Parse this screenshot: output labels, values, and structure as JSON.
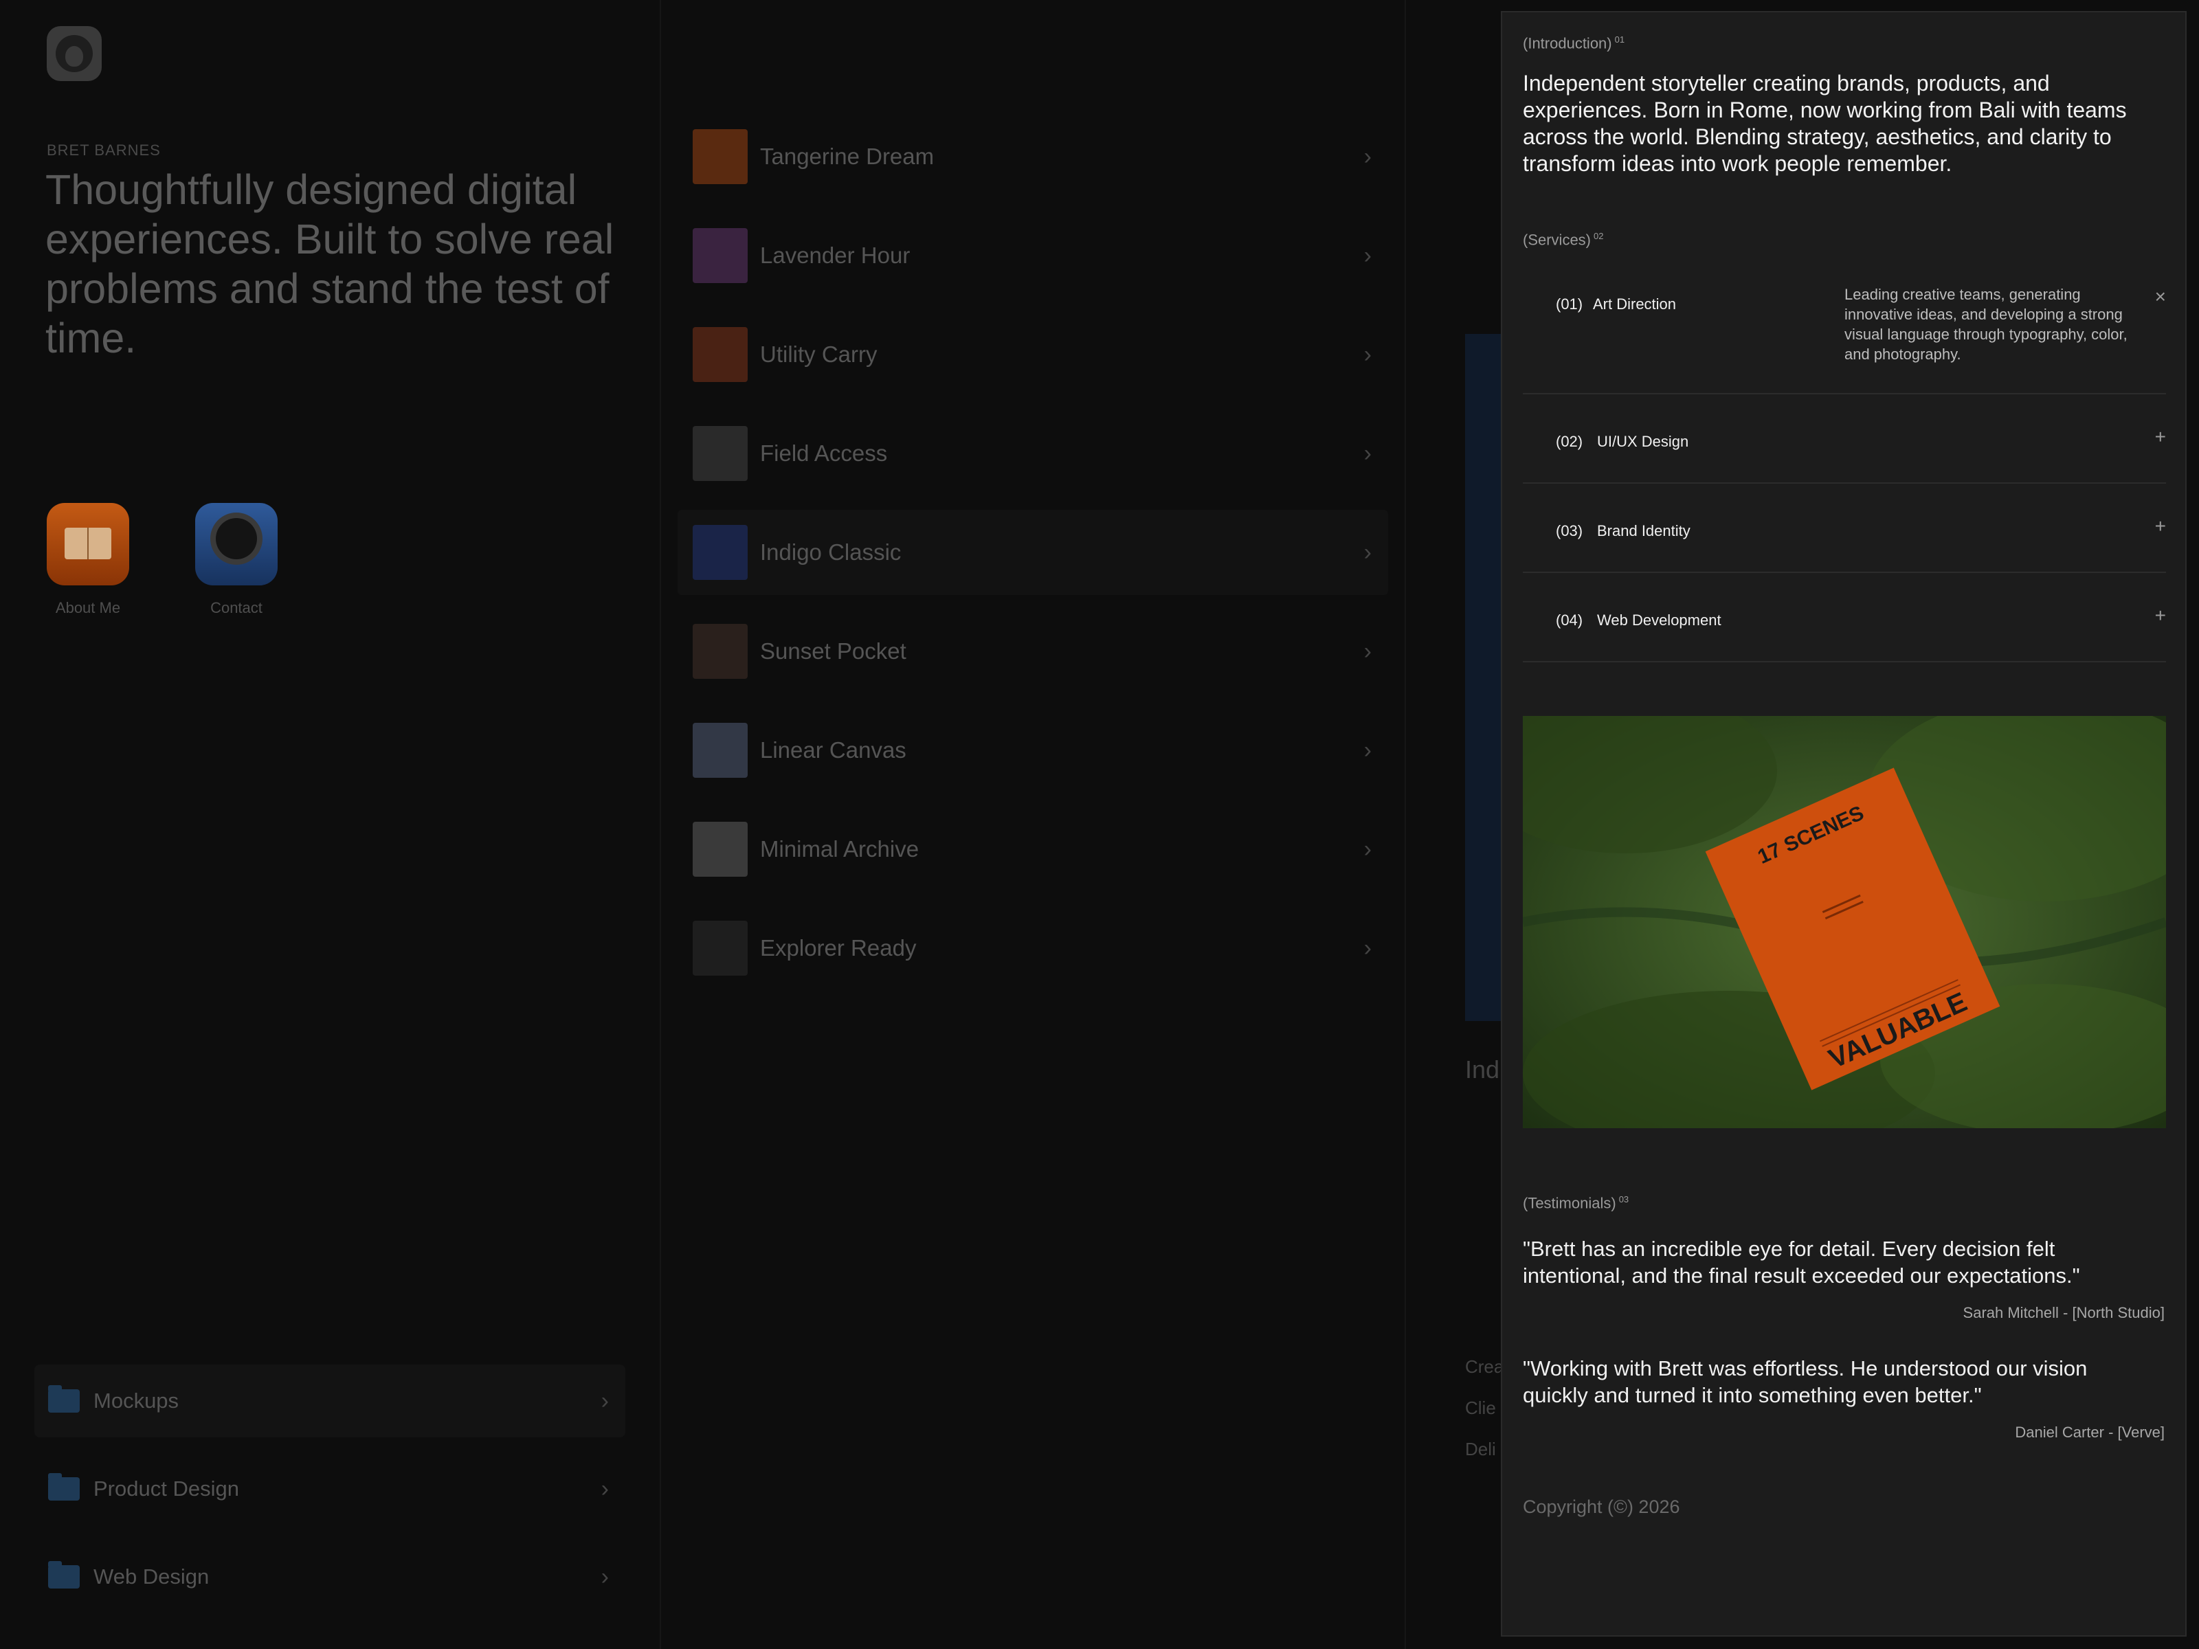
{
  "profile": {
    "eyebrow": "BRET BARNES",
    "headline": "Thoughtfully designed digital experiences. Built to solve real problems and stand the test of time."
  },
  "apps": [
    {
      "label": "About Me"
    },
    {
      "label": "Contact"
    }
  ],
  "folders": [
    {
      "label": "Mockups"
    },
    {
      "label": "Product Design"
    },
    {
      "label": "Web Design"
    }
  ],
  "projects": [
    {
      "label": "Tangerine Dream",
      "color": "#5a2a10"
    },
    {
      "label": "Lavender Hour",
      "color": "#3a2340"
    },
    {
      "label": "Utility Carry",
      "color": "#4a2214"
    },
    {
      "label": "Field Access",
      "color": "#2a2a2a"
    },
    {
      "label": "Indigo Classic",
      "color": "#1a2448"
    },
    {
      "label": "Sunset Pocket",
      "color": "#2a201c"
    },
    {
      "label": "Linear Canvas",
      "color": "#323846"
    },
    {
      "label": "Minimal Archive",
      "color": "#3a3a3a"
    },
    {
      "label": "Explorer Ready",
      "color": "#1e1e1e"
    }
  ],
  "side_preview": {
    "title_fragment": "Ind",
    "lines": [
      "Crea",
      "Clie",
      "Deli"
    ]
  },
  "panel": {
    "intro_label": "(Introduction)",
    "intro_sup": "01",
    "intro_text": "Independent storyteller creating brands, products, and experiences. Born in Rome, now working from Bali with teams across the world. Blending strategy, aesthetics, and clarity to transform ideas into work people remember.",
    "services_label": "(Services)",
    "services_sup": "02",
    "services": [
      {
        "num": "(01)",
        "name": "Art Direction",
        "desc": "Leading creative teams, generating innovative ideas, and developing a strong visual language through typography, color, and photography.",
        "toggle": "×"
      },
      {
        "num": "(02)",
        "name": "UI/UX Design",
        "toggle": "+"
      },
      {
        "num": "(03)",
        "name": "Brand Identity",
        "toggle": "+"
      },
      {
        "num": "(04)",
        "name": "Web Development",
        "toggle": "+"
      }
    ],
    "photo": {
      "top_text": "17 SCENES",
      "bottom_text": "VALUABLE"
    },
    "testimonials_label": "(Testimonials)",
    "testimonials_sup": "03",
    "testimonials": [
      {
        "quote": "\"Brett has an incredible eye for detail. Every decision felt intentional, and the final result exceeded our expectations.\"",
        "author": "Sarah Mitchell - [North Studio]"
      },
      {
        "quote": "\"Working with Brett was effortless. He understood our vision quickly and turned it into something even better.\"",
        "author": "Daniel Carter - [Verve]"
      }
    ],
    "copyright": "Copyright (©) 2026"
  }
}
